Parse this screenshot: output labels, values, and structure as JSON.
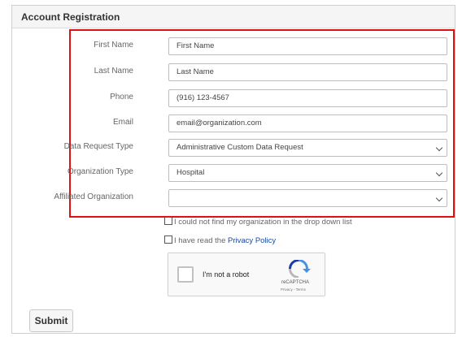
{
  "panel": {
    "title": "Account Registration"
  },
  "form": {
    "fields": [
      {
        "label": "First Name",
        "value": "First Name"
      },
      {
        "label": "Last Name",
        "value": "Last Name"
      },
      {
        "label": "Phone",
        "value": "(916) 123-4567"
      },
      {
        "label": "Email",
        "value": "email@organization.com"
      },
      {
        "label": "Data Request Type",
        "value": "Administrative Custom Data Request"
      },
      {
        "label": "Organization Type",
        "value": "Hospital"
      },
      {
        "label": "Affiliated Organization",
        "value": ""
      }
    ],
    "checkbox_not_found": "I could not find my organization in the drop down list",
    "checkbox_privacy_prefix": "I have read the",
    "checkbox_privacy_link": "Privacy Policy"
  },
  "recaptcha": {
    "label": "I'm not a robot",
    "brand": "reCAPTCHA",
    "terms": "Privacy - Terms"
  },
  "submit_label": "Submit",
  "colors": {
    "highlight_border": "#e01010",
    "link": "#1a4aa8"
  }
}
